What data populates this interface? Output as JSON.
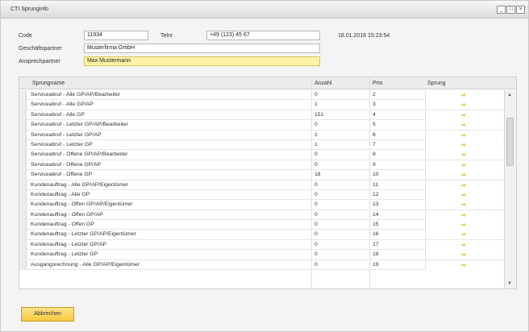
{
  "window": {
    "title": "CTI Sprunginfo",
    "controls": [
      "_",
      "□",
      "×"
    ]
  },
  "form": {
    "code_label": "Code",
    "code_value": "11934",
    "tel_label": "Telnr",
    "tel_value": "+49 (123) 45 67",
    "timestamp": "18.01.2018 15:23:54",
    "gp_label": "Geschäftspartner",
    "gp_value": "Musterfirma GmbH",
    "ap_label": "Ansprechpartner",
    "ap_value": "Max Mustermann"
  },
  "grid": {
    "headers": {
      "name": "Sprungname",
      "anzahl": "Anzahl",
      "prio": "Prio",
      "sprung": "Sprung"
    },
    "rows": [
      {
        "name": "Serviceabruf - Alle GP/AP/Bearbeiter",
        "anzahl": "0",
        "prio": "2"
      },
      {
        "name": "Serviceabruf - Alle GP/AP",
        "anzahl": "1",
        "prio": "3"
      },
      {
        "name": "Serviceabruf - Alle GP",
        "anzahl": "151",
        "prio": "4"
      },
      {
        "name": "Serviceabruf - Letzter GP/AP/Bearbeiter",
        "anzahl": "0",
        "prio": "5"
      },
      {
        "name": "Serviceabruf - Letzter GP/AP",
        "anzahl": "1",
        "prio": "6"
      },
      {
        "name": "Serviceabruf - Letzter GP",
        "anzahl": "1",
        "prio": "7"
      },
      {
        "name": "Serviceabruf - Offene GP/AP/Bearbeiter",
        "anzahl": "0",
        "prio": "8"
      },
      {
        "name": "Serviceabruf - Offene GP/AP",
        "anzahl": "0",
        "prio": "9"
      },
      {
        "name": "Serviceabruf - Offene GP",
        "anzahl": "18",
        "prio": "10"
      },
      {
        "name": "Kundenauftrag - Alle GP/AP/Eigentümer",
        "anzahl": "0",
        "prio": "11"
      },
      {
        "name": "Kundenauftrag - Alle GP",
        "anzahl": "0",
        "prio": "12"
      },
      {
        "name": "Kundenauftrag - Offen GP/AP/Eigentümer",
        "anzahl": "0",
        "prio": "13"
      },
      {
        "name": "Kundenauftrag - Offen GP/AP",
        "anzahl": "0",
        "prio": "14"
      },
      {
        "name": "Kundenauftrag - Offen GP",
        "anzahl": "0",
        "prio": "15"
      },
      {
        "name": "Kundenauftrag - Letzter GP/AP/Eigentümer",
        "anzahl": "0",
        "prio": "16"
      },
      {
        "name": "Kundenauftrag - Letzter GP/AP",
        "anzahl": "0",
        "prio": "17"
      },
      {
        "name": "Kundenauftrag - Letzter GP",
        "anzahl": "0",
        "prio": "18"
      },
      {
        "name": "Ausgangsrechnung - Alle GP/AP/Eigentümer",
        "anzahl": "0",
        "prio": "19"
      }
    ],
    "sprung_icon": "⇨"
  },
  "buttons": {
    "cancel": "Abbrechen"
  },
  "colors": {
    "highlight": "#fdf3a6",
    "accent": "#f6c93e"
  }
}
